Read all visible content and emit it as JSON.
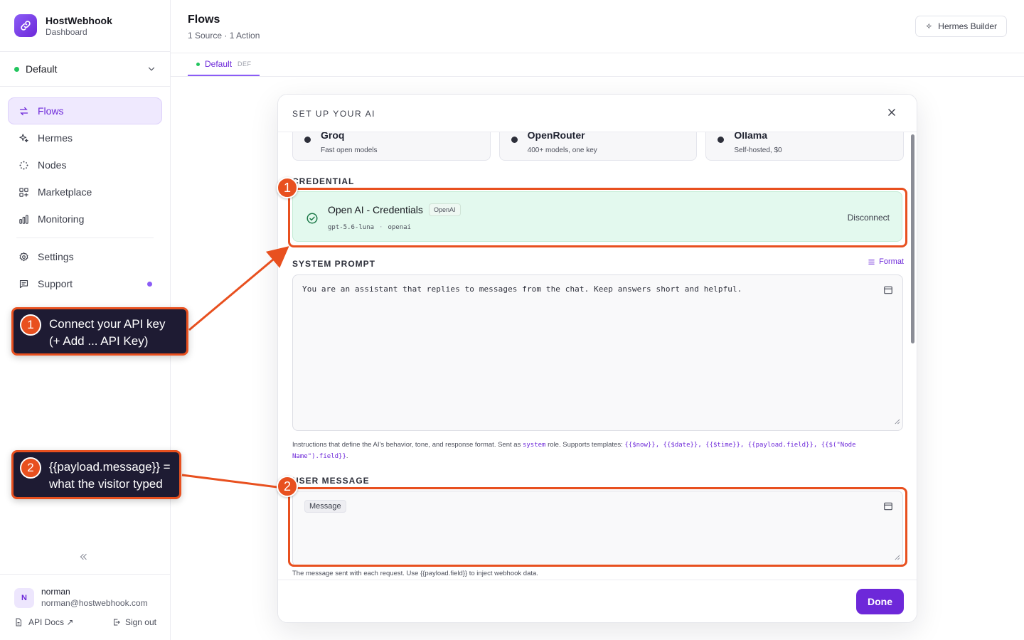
{
  "brand": {
    "name": "HostWebhook",
    "subtitle": "Dashboard"
  },
  "workspace": {
    "name": "Default"
  },
  "nav": [
    {
      "label": "Flows",
      "icon": "arrows-swap-icon",
      "active": true
    },
    {
      "label": "Hermes",
      "icon": "sparkles-icon"
    },
    {
      "label": "Nodes",
      "icon": "nodes-icon"
    },
    {
      "label": "Marketplace",
      "icon": "grid-plus-icon"
    },
    {
      "label": "Monitoring",
      "icon": "bar-chart-icon"
    },
    {
      "label": "Settings",
      "icon": "gear-icon"
    },
    {
      "label": "Support",
      "icon": "chat-icon"
    }
  ],
  "user": {
    "initial": "N",
    "name": "norman",
    "email": "norman@hostwebhook.com"
  },
  "footer": {
    "api_docs": "API Docs ↗",
    "sign_out": "Sign out"
  },
  "header": {
    "title": "Flows",
    "subtitle": "1 Source · 1 Action",
    "hermes_button": "Hermes Builder"
  },
  "tabs": [
    {
      "label": "Default",
      "badge": "DEF"
    }
  ],
  "modal": {
    "title": "SET UP YOUR AI",
    "providers": [
      {
        "name": "Groq",
        "desc": "Fast open models"
      },
      {
        "name": "OpenRouter",
        "desc": "400+ models, one key"
      },
      {
        "name": "Ollama",
        "desc": "Self-hosted, $0"
      }
    ],
    "credential": {
      "section": "CREDENTIAL",
      "name": "Open AI - Credentials",
      "badge": "OpenAI",
      "model": "gpt-5.6-luna",
      "provider": "openai",
      "action": "Disconnect"
    },
    "system_prompt": {
      "section": "SYSTEM PROMPT",
      "format": "Format",
      "value": "You are an assistant that replies to messages from the chat. Keep answers short and helpful.",
      "help_prefix": "Instructions that define the AI's behavior, tone, and response format. Sent as ",
      "help_role": "system",
      "help_middle": " role. Supports templates: ",
      "templates": "{{$now}}, {{$date}}, {{$time}}, {{payload.field}}, {{$(\"Node Name\").field}}",
      "help_end": "."
    },
    "user_message": {
      "section": "USER MESSAGE",
      "chip": "Message",
      "help": "The message sent with each request. Use {{payload.field}} to inject webhook data."
    },
    "done": "Done"
  },
  "annotations": [
    {
      "num": "1",
      "text": "Connect your API key (+ Add ... API Key)"
    },
    {
      "num": "2",
      "text": "{{payload.message}} = what the visitor typed"
    }
  ],
  "colors": {
    "accent": "#6d28d9",
    "annotation": "#e8501f",
    "success": "#22c55e"
  }
}
